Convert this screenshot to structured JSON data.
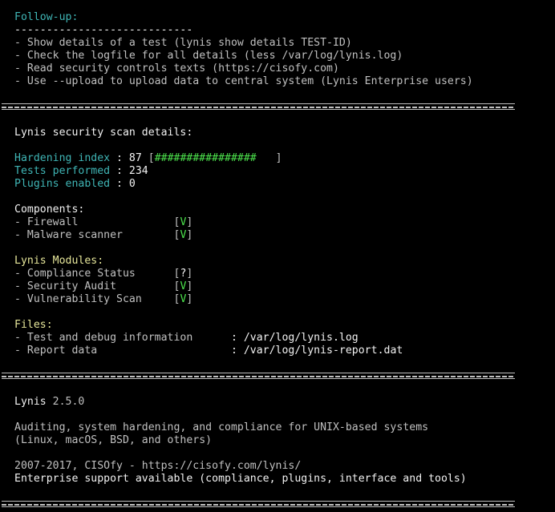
{
  "followup": {
    "heading": "Follow-up:",
    "rule": "----------------------------",
    "items": [
      "- Show details of a test (lynis show details TEST-ID)",
      "- Check the logfile for all details (less /var/log/lynis.log)",
      "- Read security controls texts (https://cisofy.com)",
      "- Use --upload to upload data to central system (Lynis Enterprise users)"
    ]
  },
  "details": {
    "title": "Lynis security scan details:",
    "hardening_label": "Hardening index",
    "hardening_sep": " : ",
    "hardening_value": "87",
    "hardening_bar_open": " [",
    "hardening_bar": "################",
    "hardening_bar_close": "   ]",
    "hardening_percent": 87,
    "tests_label": "Tests performed",
    "tests_sep": " : ",
    "tests_value": "234",
    "plugins_label": "Plugins enabled",
    "plugins_sep": " : ",
    "plugins_value": "0"
  },
  "components": {
    "heading": "Components:",
    "items": [
      {
        "name": "- Firewall               ",
        "open": "[",
        "status": "V",
        "close": "]"
      },
      {
        "name": "- Malware scanner        ",
        "open": "[",
        "status": "V",
        "close": "]"
      }
    ]
  },
  "modules": {
    "heading": "Lynis Modules:",
    "items": [
      {
        "name": "- Compliance Status      ",
        "open": "[",
        "status": "?",
        "close": "]"
      },
      {
        "name": "- Security Audit         ",
        "open": "[",
        "status": "V",
        "close": "]"
      },
      {
        "name": "- Vulnerability Scan     ",
        "open": "[",
        "status": "V",
        "close": "]"
      }
    ]
  },
  "files": {
    "heading": "Files:",
    "items": [
      {
        "label": "- Test and debug information      ",
        "path": ": /var/log/lynis.log"
      },
      {
        "label": "- Report data                     ",
        "path": ": /var/log/lynis-report.dat"
      }
    ]
  },
  "footer": {
    "name": "Lynis",
    "version": " 2.5.0",
    "desc1": "Auditing, system hardening, and compliance for UNIX-based systems",
    "desc2": "(Linux, macOS, BSD, and others)",
    "copyright": "2007-2017, CISOfy - https://cisofy.com/lynis/",
    "enterprise": "Enterprise support available (compliance, plugins, interface and tools)"
  },
  "colors": {
    "background": "#000000",
    "text": "#c0c0c0",
    "cyan": "#3fb5b5",
    "yellow": "#e6e69a",
    "green": "#4ce24c",
    "white": "#f2f2f2"
  }
}
